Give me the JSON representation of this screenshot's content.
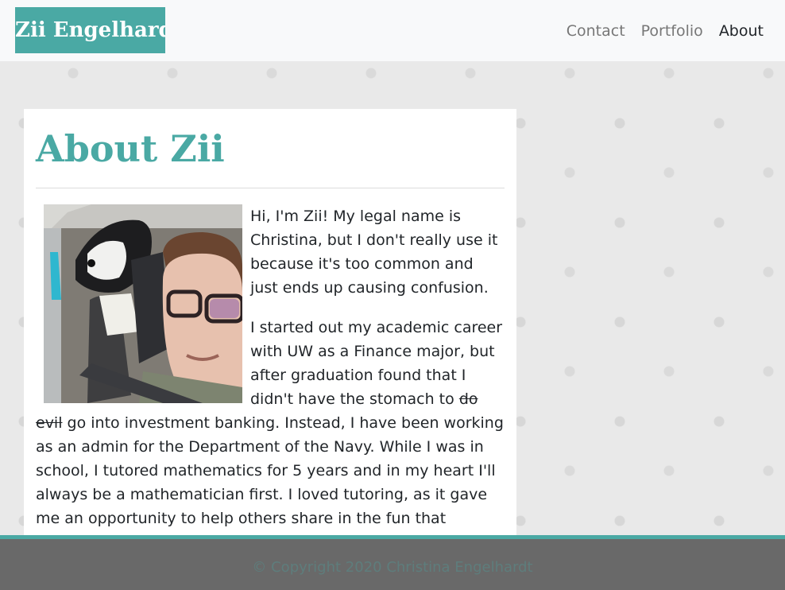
{
  "header": {
    "brand": "Zii Engelhardt",
    "nav": [
      {
        "label": "Contact",
        "active": false
      },
      {
        "label": "Portfolio",
        "active": false
      },
      {
        "label": "About",
        "active": true
      }
    ]
  },
  "main": {
    "title": "About Zii",
    "photo_icon": "photo-icon",
    "paragraphs": {
      "p1": "Hi, I'm Zii! My legal name is Christina, but I don't really use it because it's too common and just ends up causing confusion.",
      "p2_before": "I started out my academic career with UW as a Finance major, but after graduation found that I didn't have the stomach to ",
      "p2_strike": "do evil",
      "p2_after": " go into investment banking. Instead, I have been working as an admin for the Department of the Navy. While I was in school, I tutored mathematics for 5 years and in my heart I'll always be a mathematician first. I loved tutoring, as it gave me an opportunity to help others share in the fun that mathematics can be."
    }
  },
  "footer": {
    "copyright": "© Copyright 2020 Christina Engelhardt"
  },
  "colors": {
    "accent": "#4aa9a4",
    "footer_bg": "#696969",
    "page_bg": "#e9e9e9"
  }
}
